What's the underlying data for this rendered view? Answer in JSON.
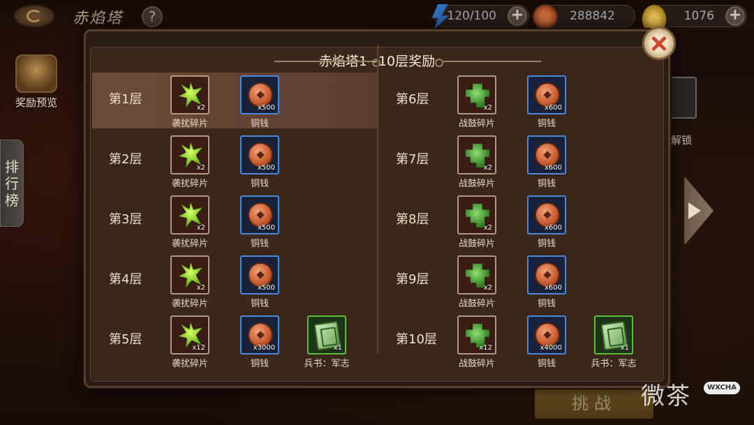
{
  "topbar": {
    "title": "赤焰塔",
    "help_label": "?",
    "energy": {
      "value": "120/100",
      "icon": "energy-icon"
    },
    "copper": {
      "value": "288842",
      "icon": "copper-coin-icon"
    },
    "gold": {
      "value": "1076",
      "icon": "gold-ingot-icon"
    },
    "plus_label": "+"
  },
  "side": {
    "reward_preview_label": "奖励预览",
    "rank_label": "排行榜",
    "unlock_label": "解锁",
    "challenge_label": "挑战"
  },
  "modal": {
    "title": "赤焰塔1~10层奖励",
    "left_rows": [
      {
        "floor": "第1层",
        "highlight": true,
        "items": [
          {
            "type": "frag-shard",
            "qty": "x2",
            "name": "袭扰碎片"
          },
          {
            "type": "coin",
            "qty": "x500",
            "name": "铜钱"
          }
        ]
      },
      {
        "floor": "第2层",
        "items": [
          {
            "type": "frag-shard",
            "qty": "x2",
            "name": "袭扰碎片"
          },
          {
            "type": "coin",
            "qty": "x500",
            "name": "铜钱"
          }
        ]
      },
      {
        "floor": "第3层",
        "items": [
          {
            "type": "frag-shard",
            "qty": "x2",
            "name": "袭扰碎片"
          },
          {
            "type": "coin",
            "qty": "x500",
            "name": "铜钱"
          }
        ]
      },
      {
        "floor": "第4层",
        "items": [
          {
            "type": "frag-shard",
            "qty": "x2",
            "name": "袭扰碎片"
          },
          {
            "type": "coin",
            "qty": "x500",
            "name": "铜钱"
          }
        ]
      },
      {
        "floor": "第5层",
        "items": [
          {
            "type": "frag-shard",
            "qty": "x12",
            "name": "袭扰碎片"
          },
          {
            "type": "coin",
            "qty": "x3000",
            "name": "铜钱"
          },
          {
            "type": "book",
            "qty": "x1",
            "name": "兵书：军志"
          }
        ]
      }
    ],
    "right_rows": [
      {
        "floor": "第6层",
        "items": [
          {
            "type": "frag-puzzle",
            "qty": "x2",
            "name": "战鼓碎片"
          },
          {
            "type": "coin",
            "qty": "x600",
            "name": "铜钱"
          }
        ]
      },
      {
        "floor": "第7层",
        "items": [
          {
            "type": "frag-puzzle",
            "qty": "x2",
            "name": "战鼓碎片"
          },
          {
            "type": "coin",
            "qty": "x600",
            "name": "铜钱"
          }
        ]
      },
      {
        "floor": "第8层",
        "items": [
          {
            "type": "frag-puzzle",
            "qty": "x2",
            "name": "战鼓碎片"
          },
          {
            "type": "coin",
            "qty": "x600",
            "name": "铜钱"
          }
        ]
      },
      {
        "floor": "第9层",
        "items": [
          {
            "type": "frag-puzzle",
            "qty": "x2",
            "name": "战鼓碎片"
          },
          {
            "type": "coin",
            "qty": "x600",
            "name": "铜钱"
          }
        ]
      },
      {
        "floor": "第10层",
        "items": [
          {
            "type": "frag-puzzle",
            "qty": "x12",
            "name": "战鼓碎片"
          },
          {
            "type": "coin",
            "qty": "x4000",
            "name": "铜钱"
          },
          {
            "type": "book",
            "qty": "x1",
            "name": "兵书：军志"
          }
        ]
      }
    ]
  },
  "watermark": {
    "text": "微茶",
    "badge": "WXCHA"
  }
}
